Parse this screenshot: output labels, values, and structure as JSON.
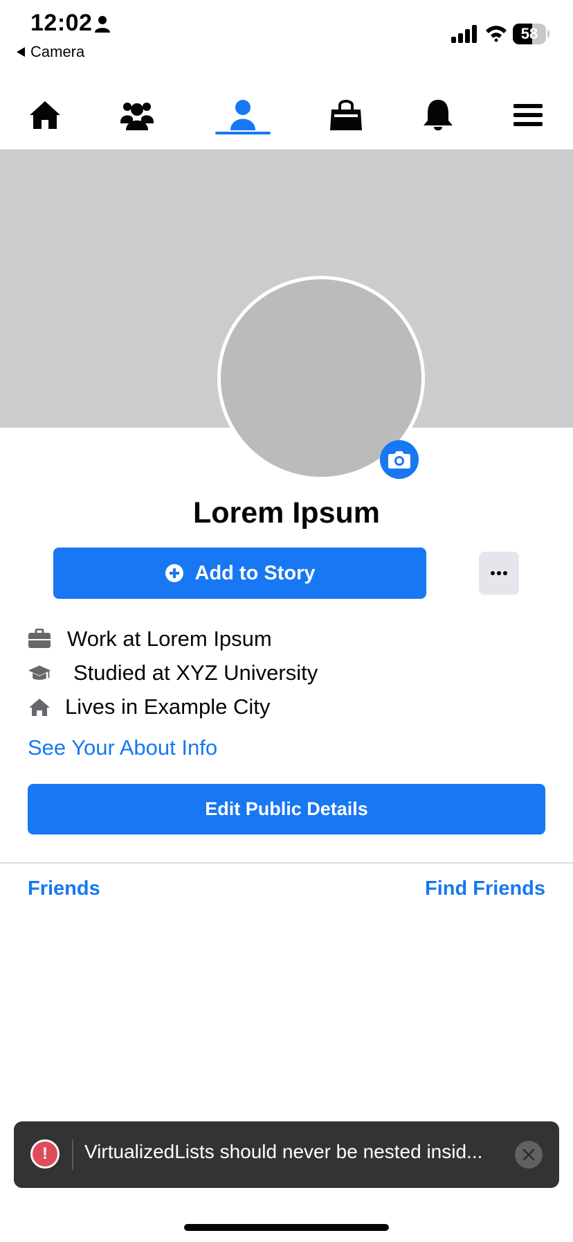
{
  "status_bar": {
    "time": "12:02",
    "back_label": "Camera",
    "battery_level": "58",
    "battery_fraction": 0.58
  },
  "tabs": [
    {
      "icon": "home-icon",
      "active": false
    },
    {
      "icon": "friends-icon",
      "active": false
    },
    {
      "icon": "profile-icon",
      "active": true
    },
    {
      "icon": "marketplace-icon",
      "active": false
    },
    {
      "icon": "notifications-icon",
      "active": false
    },
    {
      "icon": "menu-icon",
      "active": false
    }
  ],
  "profile": {
    "name": "Lorem Ipsum",
    "add_story_label": "Add to Story",
    "details": {
      "work": "Work at Lorem Ipsum",
      "education": "Studied at XYZ University",
      "home": "Lives in Example City"
    },
    "about_link": "See Your About Info",
    "edit_public_label": "Edit Public Details"
  },
  "friends": {
    "title": "Friends",
    "find_label": "Find Friends"
  },
  "toast": {
    "icon_glyph": "!",
    "message": "VirtualizedLists should never be nested insid..."
  },
  "colors": {
    "accent": "#1877f2",
    "cover": "#cccccc",
    "avatar": "#bbbbbb",
    "toast_bg": "#333333",
    "error": "#e04b5a"
  }
}
